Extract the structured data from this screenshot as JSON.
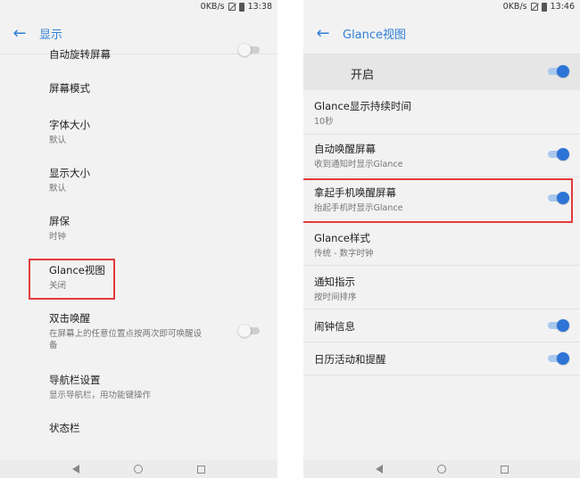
{
  "left_screen": {
    "status": {
      "speed": "0KB/s",
      "time": "13:38"
    },
    "title": "显示",
    "items": [
      {
        "title": "自动旋转屏幕",
        "subtitle": ""
      },
      {
        "title": "屏幕模式",
        "subtitle": ""
      },
      {
        "title": "字体大小",
        "subtitle": "默认"
      },
      {
        "title": "显示大小",
        "subtitle": "默认"
      },
      {
        "title": "屏保",
        "subtitle": "时钟"
      },
      {
        "title": "Glance视图",
        "subtitle": "关闭"
      },
      {
        "title": "双击唤醒",
        "subtitle": "在屏幕上的任意位置点按两次即可唤醒设",
        "subtitle2": "备"
      },
      {
        "title": "导航栏设置",
        "subtitle": "显示导航栏，用功能键操作"
      },
      {
        "title": "状态栏",
        "subtitle": ""
      }
    ]
  },
  "right_screen": {
    "status": {
      "speed": "0KB/s",
      "time": "13:46"
    },
    "title": "Glance视图",
    "master": {
      "label": "开启",
      "on": true
    },
    "items": [
      {
        "title": "Glance显示持续时间",
        "subtitle": "10秒"
      },
      {
        "title": "自动唤醒屏幕",
        "subtitle": "收到通知时显示Glance",
        "on": true
      },
      {
        "title": "拿起手机唤醒屏幕",
        "subtitle": "抬起手机时显示Glance",
        "on": true
      },
      {
        "title": "Glance样式",
        "subtitle": "传统 - 数字时钟"
      },
      {
        "title": "通知指示",
        "subtitle": "按时间排序"
      },
      {
        "title": "闹钟信息",
        "subtitle": "",
        "on": true
      },
      {
        "title": "日历活动和提醒",
        "subtitle": "",
        "on": true
      }
    ]
  },
  "colors": {
    "accent": "#2f7fd6",
    "switch_on": "#2d74d6",
    "highlight": "#e23b3b"
  },
  "icons": {
    "back": "arrow-left-icon",
    "nav_back": "triangle-back-icon",
    "nav_home": "circle-home-icon",
    "nav_recent": "square-recent-icon"
  }
}
